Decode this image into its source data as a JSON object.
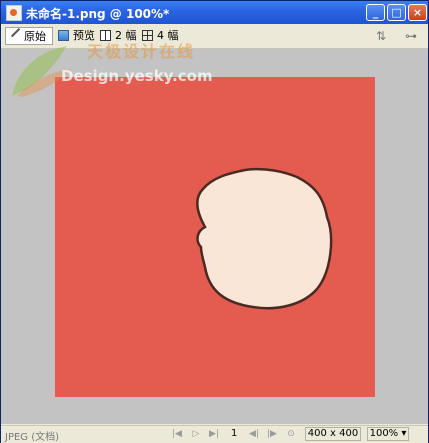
{
  "window": {
    "title": "未命名-1.png @ 100%*",
    "controls": {
      "minimize": "_",
      "maximize": "□",
      "close": "×"
    }
  },
  "toolbar": {
    "tabs": [
      {
        "label": "原始",
        "icon": "pencil-icon",
        "active": true
      },
      {
        "label": "预览",
        "icon": "preview-icon",
        "active": false
      },
      {
        "label": "2 幅",
        "icon": "two-up-icon",
        "active": false
      },
      {
        "label": "4 幅",
        "icon": "four-up-icon",
        "active": false
      }
    ],
    "right_icons": [
      "quick-export-icon",
      "page-view-icon"
    ]
  },
  "watermark": {
    "chinese": "天极设计在线",
    "english": "Design.yesky.com"
  },
  "canvas": {
    "background_color": "#c3c3c3",
    "document_color": "#e45b4f",
    "shape_fill": "#fae6d7",
    "shape_stroke": "#4a2a22"
  },
  "status_bar": {
    "format_label": "JPEG (文档)",
    "frame_number": "1",
    "dimensions": "400 x 400",
    "zoom": "100%"
  }
}
